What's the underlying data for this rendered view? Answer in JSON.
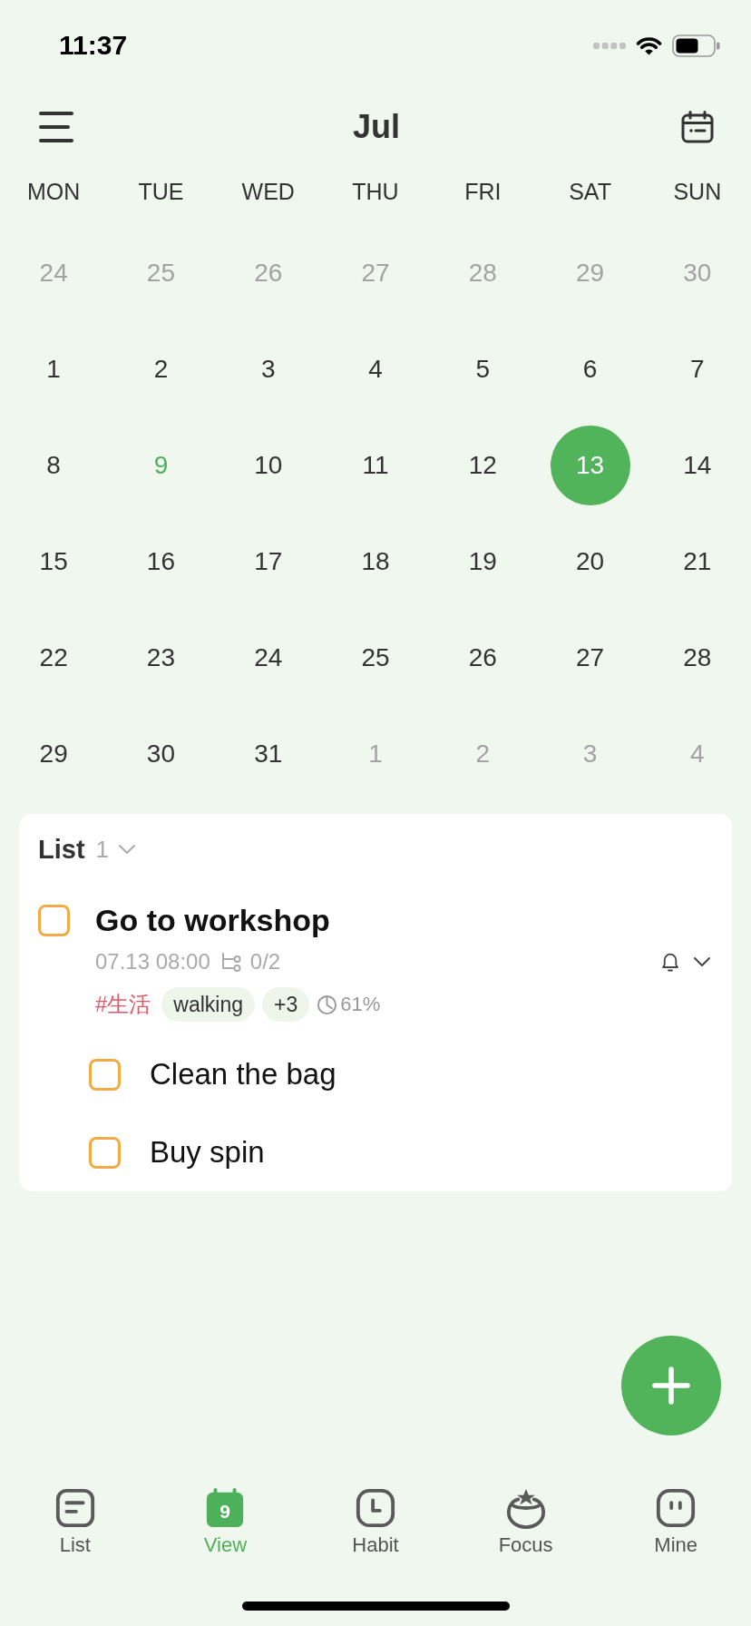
{
  "status_bar": {
    "time": "11:37"
  },
  "header": {
    "title": "Jul"
  },
  "weekdays": [
    "MON",
    "TUE",
    "WED",
    "THU",
    "FRI",
    "SAT",
    "SUN"
  ],
  "calendar": {
    "days": [
      {
        "day": "24",
        "in_month": false,
        "today": false,
        "selected": false
      },
      {
        "day": "25",
        "in_month": false,
        "today": false,
        "selected": false
      },
      {
        "day": "26",
        "in_month": false,
        "today": false,
        "selected": false
      },
      {
        "day": "27",
        "in_month": false,
        "today": false,
        "selected": false
      },
      {
        "day": "28",
        "in_month": false,
        "today": false,
        "selected": false
      },
      {
        "day": "29",
        "in_month": false,
        "today": false,
        "selected": false
      },
      {
        "day": "30",
        "in_month": false,
        "today": false,
        "selected": false
      },
      {
        "day": "1",
        "in_month": true,
        "today": false,
        "selected": false
      },
      {
        "day": "2",
        "in_month": true,
        "today": false,
        "selected": false
      },
      {
        "day": "3",
        "in_month": true,
        "today": false,
        "selected": false
      },
      {
        "day": "4",
        "in_month": true,
        "today": false,
        "selected": false
      },
      {
        "day": "5",
        "in_month": true,
        "today": false,
        "selected": false
      },
      {
        "day": "6",
        "in_month": true,
        "today": false,
        "selected": false
      },
      {
        "day": "7",
        "in_month": true,
        "today": false,
        "selected": false
      },
      {
        "day": "8",
        "in_month": true,
        "today": false,
        "selected": false
      },
      {
        "day": "9",
        "in_month": true,
        "today": true,
        "selected": false
      },
      {
        "day": "10",
        "in_month": true,
        "today": false,
        "selected": false
      },
      {
        "day": "11",
        "in_month": true,
        "today": false,
        "selected": false
      },
      {
        "day": "12",
        "in_month": true,
        "today": false,
        "selected": false
      },
      {
        "day": "13",
        "in_month": true,
        "today": false,
        "selected": true
      },
      {
        "day": "14",
        "in_month": true,
        "today": false,
        "selected": false
      },
      {
        "day": "15",
        "in_month": true,
        "today": false,
        "selected": false
      },
      {
        "day": "16",
        "in_month": true,
        "today": false,
        "selected": false
      },
      {
        "day": "17",
        "in_month": true,
        "today": false,
        "selected": false
      },
      {
        "day": "18",
        "in_month": true,
        "today": false,
        "selected": false
      },
      {
        "day": "19",
        "in_month": true,
        "today": false,
        "selected": false
      },
      {
        "day": "20",
        "in_month": true,
        "today": false,
        "selected": false
      },
      {
        "day": "21",
        "in_month": true,
        "today": false,
        "selected": false
      },
      {
        "day": "22",
        "in_month": true,
        "today": false,
        "selected": false
      },
      {
        "day": "23",
        "in_month": true,
        "today": false,
        "selected": false
      },
      {
        "day": "24",
        "in_month": true,
        "today": false,
        "selected": false
      },
      {
        "day": "25",
        "in_month": true,
        "today": false,
        "selected": false
      },
      {
        "day": "26",
        "in_month": true,
        "today": false,
        "selected": false
      },
      {
        "day": "27",
        "in_month": true,
        "today": false,
        "selected": false
      },
      {
        "day": "28",
        "in_month": true,
        "today": false,
        "selected": false
      },
      {
        "day": "29",
        "in_month": true,
        "today": false,
        "selected": false
      },
      {
        "day": "30",
        "in_month": true,
        "today": false,
        "selected": false
      },
      {
        "day": "31",
        "in_month": true,
        "today": false,
        "selected": false
      },
      {
        "day": "1",
        "in_month": false,
        "today": false,
        "selected": false
      },
      {
        "day": "2",
        "in_month": false,
        "today": false,
        "selected": false
      },
      {
        "day": "3",
        "in_month": false,
        "today": false,
        "selected": false
      },
      {
        "day": "4",
        "in_month": false,
        "today": false,
        "selected": false
      }
    ]
  },
  "task_list": {
    "title": "List",
    "count": "1",
    "tasks": [
      {
        "title": "Go to workshop",
        "checked": false,
        "date": "07.13 08:00",
        "subtask_count": "0/2",
        "tags": [
          {
            "text": "#生活",
            "kind": "hashtag"
          },
          {
            "text": "walking",
            "kind": "chip"
          },
          {
            "text": "+3",
            "kind": "chip"
          }
        ],
        "progress": "61%",
        "subtasks": [
          {
            "title": "Clean the bag",
            "checked": false
          },
          {
            "title": "Buy spin",
            "checked": false
          }
        ]
      }
    ]
  },
  "tabs": [
    {
      "label": "List",
      "selected": false
    },
    {
      "label": "View",
      "selected": true,
      "icon_text": "9"
    },
    {
      "label": "Habit",
      "selected": false
    },
    {
      "label": "Focus",
      "selected": false
    },
    {
      "label": "Mine",
      "selected": false
    }
  ]
}
